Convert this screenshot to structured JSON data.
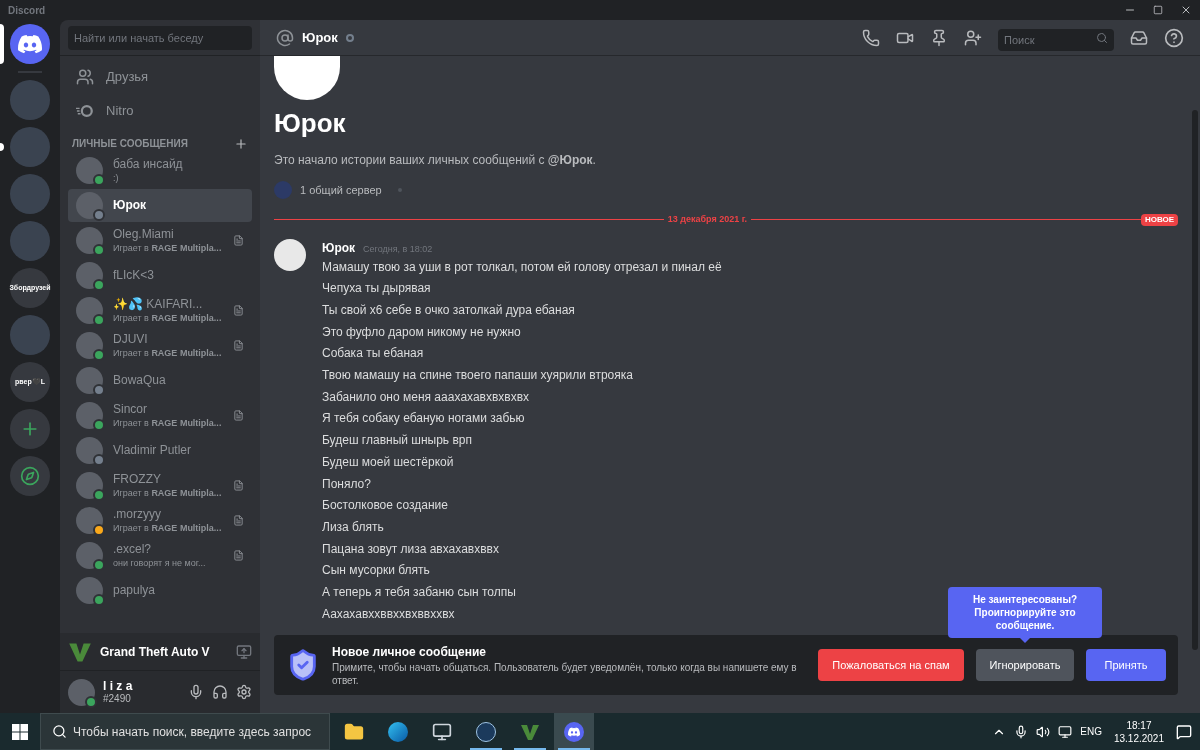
{
  "window": {
    "title": "Discord"
  },
  "servers": [
    {
      "kind": "home",
      "selected": true,
      "unread": false
    },
    {
      "kind": "image",
      "selected": false,
      "unread": false
    },
    {
      "kind": "image",
      "selected": false,
      "unread": true
    },
    {
      "kind": "image",
      "selected": false,
      "unread": false
    },
    {
      "kind": "image",
      "selected": false,
      "unread": false
    },
    {
      "kind": "text",
      "label": "Збордрузей",
      "selected": false,
      "unread": false
    },
    {
      "kind": "image",
      "selected": false,
      "unread": false
    },
    {
      "kind": "text",
      "label": "рвер🖤L",
      "selected": false,
      "unread": false
    },
    {
      "kind": "add",
      "selected": false,
      "unread": false
    },
    {
      "kind": "explore",
      "selected": false,
      "unread": false
    }
  ],
  "sidebar": {
    "search_placeholder": "Найти или начать беседу",
    "nav": [
      {
        "kind": "friends",
        "label": "Друзья"
      },
      {
        "kind": "nitro",
        "label": "Nitro"
      }
    ],
    "dm_header": "ЛИЧНЫЕ СООБЩЕНИЯ",
    "dms": [
      {
        "name": "баба инсайд",
        "activity": ":)",
        "color": "#3ba55d",
        "selected": false,
        "details": false
      },
      {
        "name": "Юрок",
        "color": "#747f8d",
        "selected": true,
        "details": false
      },
      {
        "name": "Oleg.Miami",
        "activity": "Играет в **RAGE Multipla...**",
        "color": "#3ba55d",
        "selected": false,
        "details": true
      },
      {
        "name": "fLIcK<3",
        "color": "#3ba55d",
        "selected": false,
        "details": false
      },
      {
        "name": "✨💦 KAIFARI...",
        "activity": "Играет в **RAGE Multipla...**",
        "color": "#3ba55d",
        "selected": false,
        "details": true
      },
      {
        "name": "DJUVI",
        "activity": "Играет в **RAGE Multipla...**",
        "color": "#3ba55d",
        "selected": false,
        "details": true
      },
      {
        "name": "BowaQua",
        "color": "#747f8d",
        "selected": false,
        "details": false
      },
      {
        "name": "Sincor",
        "activity": "Играет в **RAGE Multipla...**",
        "color": "#3ba55d",
        "selected": false,
        "details": true
      },
      {
        "name": "Vladimir Putler",
        "color": "#747f8d",
        "selected": false,
        "details": false
      },
      {
        "name": "FROZZY",
        "activity": "Играет в **RAGE Multipla...**",
        "color": "#3ba55d",
        "selected": false,
        "details": true
      },
      {
        "name": ".morzyyy",
        "activity": "Играет в **RAGE Multipla...**",
        "color": "#faa81a",
        "selected": false,
        "details": true
      },
      {
        "name": ".excel?",
        "activity": "они говорят я не мог...",
        "color": "#3ba55d",
        "selected": false,
        "details": true
      },
      {
        "name": "papulya",
        "color": "#3ba55d",
        "selected": false,
        "details": false
      }
    ],
    "game": "Grand Theft Auto V",
    "user": {
      "name": "l i z a",
      "tag": "#2490",
      "color": "#3ba55d"
    }
  },
  "header": {
    "name": "Юрок",
    "color": "#747f8d",
    "search_placeholder": "Поиск"
  },
  "intro": {
    "name": "Юрок",
    "text": "Это начало истории ваших личных сообщений с **@Юрок**.",
    "mutual": "1 общий сервер"
  },
  "divider": {
    "date": "13 декабря 2021 г.",
    "badge": "НОВОЕ"
  },
  "message": {
    "author": "Юрок",
    "time": "Сегодня, в 18:02",
    "lines": [
      "Мамашу твою за уши в рот толкал, потом ей голову отрезал и пинал её",
      "Чепуха ты дырявая",
      "Ты свой х6 себе в очко затолкай дура ебаная",
      "Это фуфло даром никому не нужно",
      "Собака ты ебаная",
      "Твою мамашу на спине твоего папаши хуярили втрояка",
      "Забанило оно меня аааxахавхвхвхвх",
      "Я тебя собаку ебаную ногами забью",
      "Будеш главный шнырь врп",
      "Будеш моей шестёркой",
      "Поняло?",
      "Бостолковое создание",
      "Лиза блять",
      "Пацана зовут лиза авхахавхввх",
      "Сын мусорки блять",
      "А теперь я тебя забаню сын толпы",
      "Аахахавххввххвхввххвх"
    ]
  },
  "request": {
    "title": "Новое личное сообщение",
    "text": "Примите, чтобы начать общаться. Пользователь будет уведомлён, только когда вы напишете ему в ответ.",
    "buttons": [
      {
        "kind": "danger",
        "label": "Пожаловаться на спам"
      },
      {
        "kind": "secondary",
        "label": "Игнорировать"
      },
      {
        "kind": "primary",
        "label": "Принять"
      }
    ],
    "tooltip": "Не заинтересованы? Проигнорируйте это сообщение."
  },
  "taskbar": {
    "search_placeholder": "Чтобы начать поиск, введите здесь запрос",
    "apps": [
      {
        "kind": "folder",
        "running": false,
        "selected": false
      },
      {
        "kind": "edge",
        "running": false,
        "selected": false
      },
      {
        "kind": "monitor",
        "running": false,
        "selected": false
      },
      {
        "kind": "steam",
        "running": true,
        "selected": false
      },
      {
        "kind": "gta",
        "running": true,
        "selected": false
      },
      {
        "kind": "discord",
        "running": true,
        "selected": true
      }
    ],
    "language": "ENG",
    "time": "18:17",
    "date": "13.12.2021"
  }
}
